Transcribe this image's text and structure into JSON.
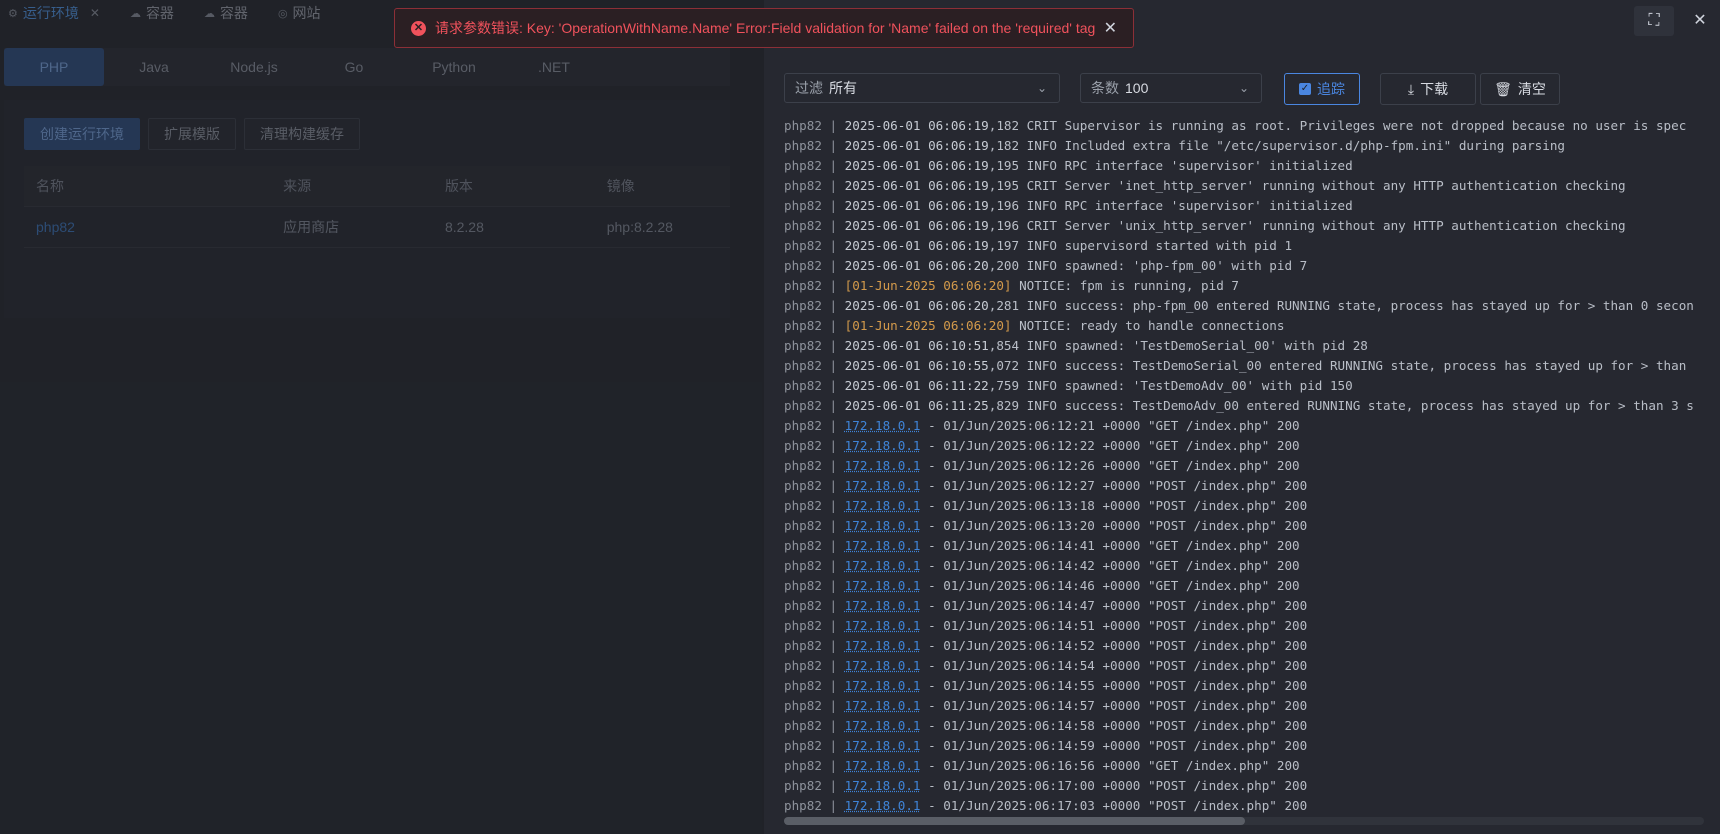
{
  "tabs": [
    {
      "label": "运行环境",
      "active": true
    },
    {
      "label": "容器"
    },
    {
      "label": "容器"
    },
    {
      "label": "网站"
    }
  ],
  "languages": [
    "PHP",
    "Java",
    "Node.js",
    "Go",
    "Python",
    ".NET"
  ],
  "panel": {
    "buttons": [
      "创建运行环境",
      "扩展模版",
      "清理构建缓存"
    ],
    "columns": [
      "名称",
      "来源",
      "版本",
      "镜像"
    ],
    "rows": [
      [
        "php82",
        "应用商店",
        "8.2.28",
        "php:8.2.28"
      ]
    ]
  },
  "toast": {
    "text": "请求参数错误: Key: 'OperationWithName.Name' Error:Field validation for 'Name' failed on the 'required' tag"
  },
  "controls": {
    "filter_label": "过滤",
    "filter_value": "所有",
    "count_label": "条数",
    "count_value": "100",
    "track_label": "追踪",
    "download_label": "下载",
    "clear_label": "清空"
  },
  "log_prefix": "php82",
  "logs": [
    {
      "ts": "2025-06-01 06:06:19",
      "ms": ",182",
      "msg": " CRIT Supervisor is running as root. Privileges were not dropped because no user is spec"
    },
    {
      "ts": "2025-06-01 06:06:19",
      "ms": ",182",
      "msg": " INFO Included extra file \"/etc/supervisor.d/php-fpm.ini\" during parsing"
    },
    {
      "ts": "2025-06-01 06:06:19",
      "ms": ",195",
      "msg": " INFO RPC interface 'supervisor' initialized"
    },
    {
      "ts": "2025-06-01 06:06:19",
      "ms": ",195",
      "msg": " CRIT Server 'inet_http_server' running without any HTTP authentication checking"
    },
    {
      "ts": "2025-06-01 06:06:19",
      "ms": ",196",
      "msg": " INFO RPC interface 'supervisor' initialized"
    },
    {
      "ts": "2025-06-01 06:06:19",
      "ms": ",196",
      "msg": " CRIT Server 'unix_http_server' running without any HTTP authentication checking"
    },
    {
      "ts": "2025-06-01 06:06:19",
      "ms": ",197",
      "msg": " INFO supervisord started with pid 1"
    },
    {
      "ts": "2025-06-01 06:06:20",
      "ms": ",200",
      "msg": " INFO spawned: 'php-fpm_00' with pid 7"
    },
    {
      "bracket": "[01-Jun-2025 06:06:20]",
      "msg": " NOTICE: fpm is running, pid 7"
    },
    {
      "ts": "2025-06-01 06:06:20",
      "ms": ",281",
      "msg": " INFO success: php-fpm_00 entered RUNNING state, process has stayed up for > than 0 secon"
    },
    {
      "bracket": "[01-Jun-2025 06:06:20]",
      "msg": " NOTICE: ready to handle connections"
    },
    {
      "ts": "2025-06-01 06:10:51",
      "ms": ",854",
      "msg": " INFO spawned: 'TestDemoSerial_00' with pid 28"
    },
    {
      "ts": "2025-06-01 06:10:55",
      "ms": ",072",
      "msg": " INFO success: TestDemoSerial_00 entered RUNNING state, process has stayed up for > than"
    },
    {
      "ts": "2025-06-01 06:11:22",
      "ms": ",759",
      "msg": " INFO spawned: 'TestDemoAdv_00' with pid 150"
    },
    {
      "ts": "2025-06-01 06:11:25",
      "ms": ",829",
      "msg": " INFO success: TestDemoAdv_00 entered RUNNING state, process has stayed up for > than 3 s"
    },
    {
      "ip": "172.18.0.1",
      "msg": " - 01/Jun/2025:06:12:21 +0000 \"GET /index.php\" 200"
    },
    {
      "ip": "172.18.0.1",
      "msg": " - 01/Jun/2025:06:12:22 +0000 \"GET /index.php\" 200"
    },
    {
      "ip": "172.18.0.1",
      "msg": " - 01/Jun/2025:06:12:26 +0000 \"GET /index.php\" 200"
    },
    {
      "ip": "172.18.0.1",
      "msg": " - 01/Jun/2025:06:12:27 +0000 \"POST /index.php\" 200"
    },
    {
      "ip": "172.18.0.1",
      "msg": " - 01/Jun/2025:06:13:18 +0000 \"POST /index.php\" 200"
    },
    {
      "ip": "172.18.0.1",
      "msg": " - 01/Jun/2025:06:13:20 +0000 \"POST /index.php\" 200"
    },
    {
      "ip": "172.18.0.1",
      "msg": " - 01/Jun/2025:06:14:41 +0000 \"GET /index.php\" 200"
    },
    {
      "ip": "172.18.0.1",
      "msg": " - 01/Jun/2025:06:14:42 +0000 \"GET /index.php\" 200"
    },
    {
      "ip": "172.18.0.1",
      "msg": " - 01/Jun/2025:06:14:46 +0000 \"GET /index.php\" 200"
    },
    {
      "ip": "172.18.0.1",
      "msg": " - 01/Jun/2025:06:14:47 +0000 \"POST /index.php\" 200"
    },
    {
      "ip": "172.18.0.1",
      "msg": " - 01/Jun/2025:06:14:51 +0000 \"POST /index.php\" 200"
    },
    {
      "ip": "172.18.0.1",
      "msg": " - 01/Jun/2025:06:14:52 +0000 \"POST /index.php\" 200"
    },
    {
      "ip": "172.18.0.1",
      "msg": " - 01/Jun/2025:06:14:54 +0000 \"POST /index.php\" 200"
    },
    {
      "ip": "172.18.0.1",
      "msg": " - 01/Jun/2025:06:14:55 +0000 \"POST /index.php\" 200"
    },
    {
      "ip": "172.18.0.1",
      "msg": " - 01/Jun/2025:06:14:57 +0000 \"POST /index.php\" 200"
    },
    {
      "ip": "172.18.0.1",
      "msg": " - 01/Jun/2025:06:14:58 +0000 \"POST /index.php\" 200"
    },
    {
      "ip": "172.18.0.1",
      "msg": " - 01/Jun/2025:06:14:59 +0000 \"POST /index.php\" 200"
    },
    {
      "ip": "172.18.0.1",
      "msg": " - 01/Jun/2025:06:16:56 +0000 \"GET /index.php\" 200"
    },
    {
      "ip": "172.18.0.1",
      "msg": " - 01/Jun/2025:06:17:00 +0000 \"POST /index.php\" 200"
    },
    {
      "ip": "172.18.0.1",
      "msg": " - 01/Jun/2025:06:17:03 +0000 \"POST /index.php\" 200"
    }
  ],
  "colors": {
    "accent": "#4a86e0",
    "error": "#f0525c",
    "bracket_ts": "#d39a4b",
    "ip_link": "#3f84d8"
  },
  "icons": {
    "fullscreen": "fullscreen-icon",
    "close": "close-icon"
  }
}
